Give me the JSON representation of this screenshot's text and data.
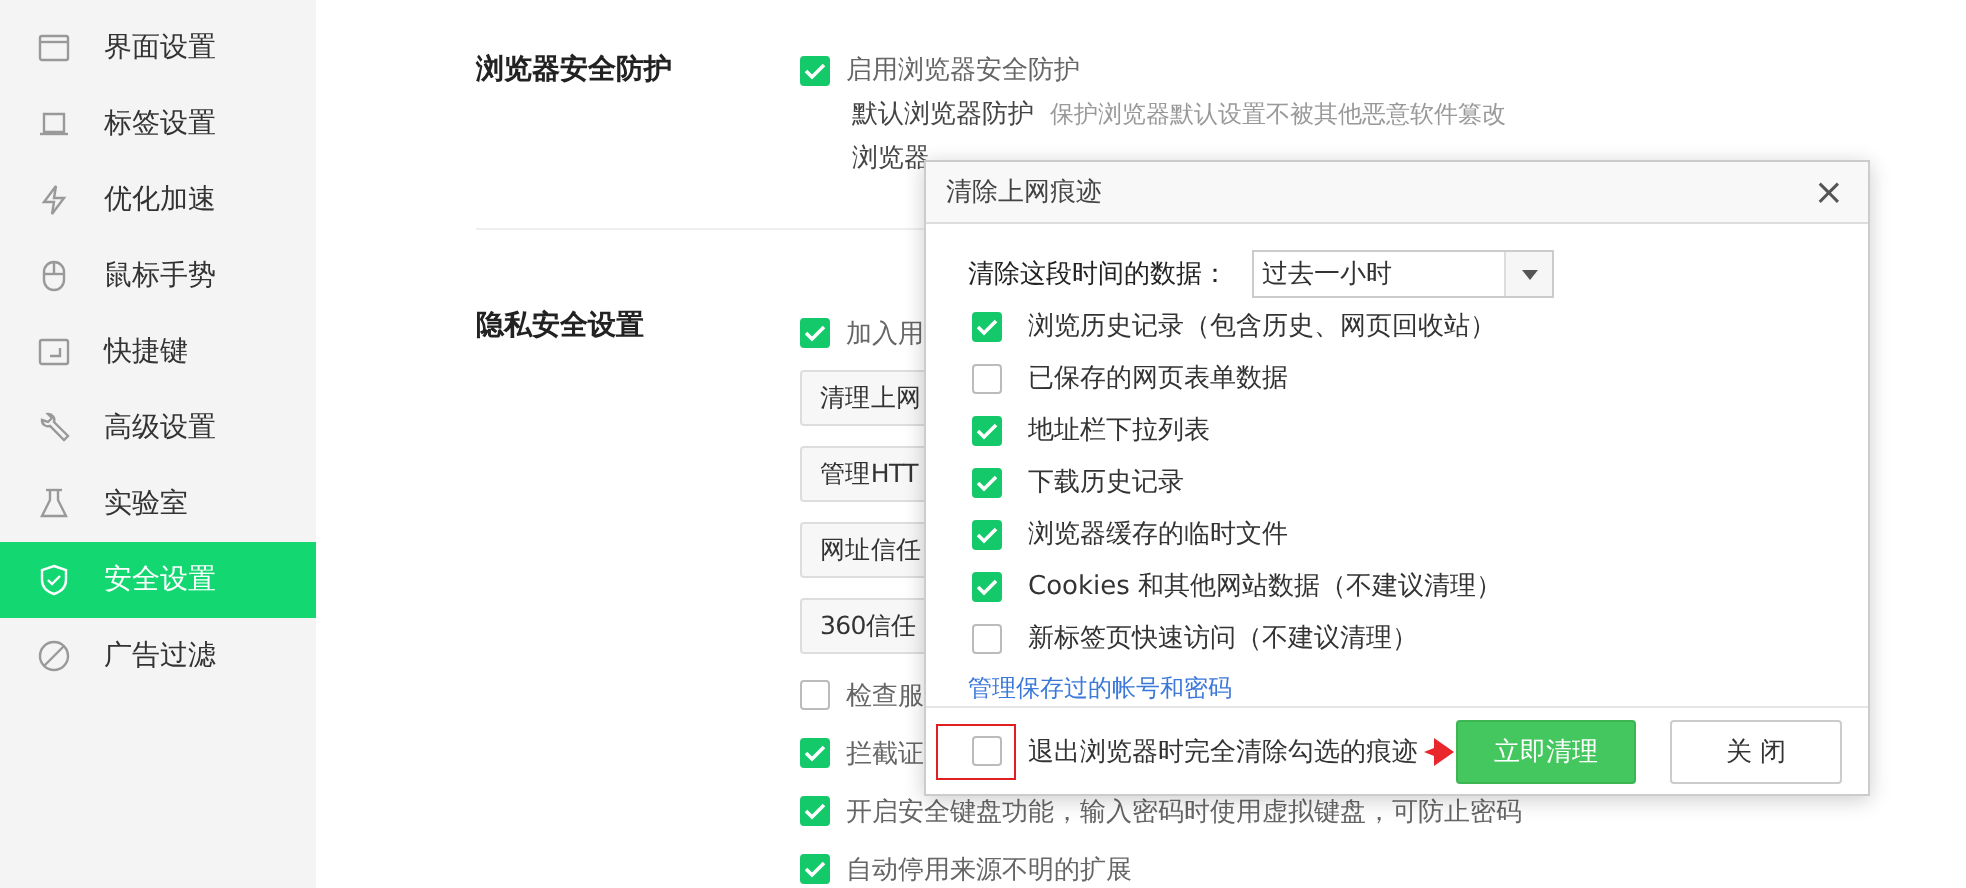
{
  "sidebar": {
    "items": [
      {
        "label": "界面设置",
        "selected": false
      },
      {
        "label": "标签设置",
        "selected": false
      },
      {
        "label": "优化加速",
        "selected": false
      },
      {
        "label": "鼠标手势",
        "selected": false
      },
      {
        "label": "快捷键",
        "selected": false
      },
      {
        "label": "高级设置",
        "selected": false
      },
      {
        "label": "实验室",
        "selected": false
      },
      {
        "label": "安全设置",
        "selected": true
      },
      {
        "label": "广告过滤",
        "selected": false
      }
    ]
  },
  "sections": [
    {
      "heading": "浏览器安全防护",
      "rows": [
        {
          "kind": "checkbox",
          "label": "启用浏览器安全防护",
          "checked": true
        },
        {
          "kind": "info",
          "label": "默认浏览器防护",
          "description": "保护浏览器默认设置不被其他恶意软件篡改"
        },
        {
          "kind": "info",
          "label": "浏览器"
        }
      ]
    },
    {
      "heading": "隐私安全设置",
      "rows": [
        {
          "kind": "checkbox",
          "label": "加入用",
          "checked": true
        },
        {
          "kind": "button",
          "label": "清理上网"
        },
        {
          "kind": "button",
          "label": "管理HTT"
        },
        {
          "kind": "button",
          "label": "网址信任"
        },
        {
          "kind": "button",
          "label": "360信任"
        },
        {
          "kind": "checkbox",
          "label": "检查服",
          "checked": false
        },
        {
          "kind": "checkbox",
          "label": "拦截证",
          "checked": true
        },
        {
          "kind": "checkbox",
          "label": "开启安全键盘功能，输入密码时使用虚拟键盘，可防止密码",
          "checked": true
        },
        {
          "kind": "checkbox",
          "label": "自动停用来源不明的扩展",
          "checked": true
        }
      ]
    }
  ],
  "dialog": {
    "title": "清除上网痕迹",
    "close": "×",
    "range_label": "清除这段时间的数据：",
    "range_value": "过去一小时",
    "options": [
      {
        "label": "浏览历史记录（包含历史、网页回收站）",
        "checked": true
      },
      {
        "label": "已保存的网页表单数据",
        "checked": false
      },
      {
        "label": "地址栏下拉列表",
        "checked": true
      },
      {
        "label": "下载历史记录",
        "checked": true
      },
      {
        "label": "浏览器缓存的临时文件",
        "checked": true
      },
      {
        "label": "Cookies 和其他网站数据（不建议清理）",
        "checked": true
      },
      {
        "label": "新标签页快速访问（不建议清理）",
        "checked": false
      }
    ],
    "link": "管理保存过的帐号和密码",
    "exit_option": {
      "label": "退出浏览器时完全清除勾选的痕迹",
      "checked": false
    },
    "buttons": [
      {
        "label": "立即清理",
        "kind": "primary"
      },
      {
        "label": "关 闭",
        "kind": "secondary"
      }
    ]
  }
}
